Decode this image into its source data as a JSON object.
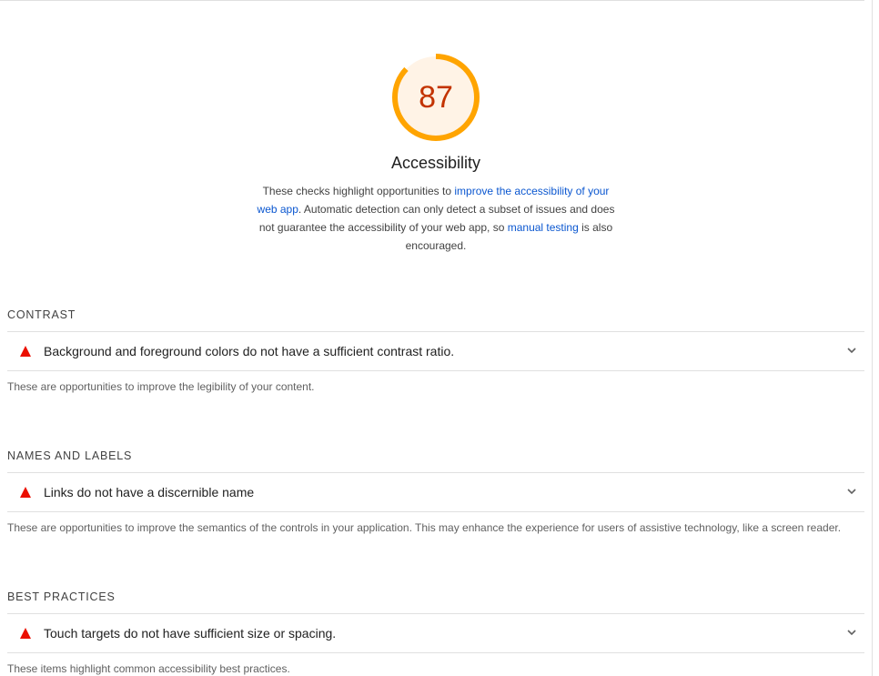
{
  "gauge": {
    "score": "87",
    "score_fraction": 0.87,
    "ring_color": "#ffa400",
    "fill_color": "#fff3e6",
    "text_color": "#c33300"
  },
  "category": {
    "title": "Accessibility",
    "description": {
      "part1": "These checks highlight opportunities to ",
      "link1": "improve the accessibility of your web app",
      "part2": ". Automatic detection can only detect a subset of issues and does not guarantee the accessibility of your web app, so ",
      "link2": "manual testing",
      "part3": " is also encouraged."
    }
  },
  "groups": [
    {
      "heading": "CONTRAST",
      "audit_title": "Background and foreground colors do not have a sufficient contrast ratio.",
      "audit_status_icon": "fail-triangle-icon",
      "expand_icon": "chevron-down-icon",
      "description": "These are opportunities to improve the legibility of your content."
    },
    {
      "heading": "NAMES AND LABELS",
      "audit_title": "Links do not have a discernible name",
      "audit_status_icon": "fail-triangle-icon",
      "expand_icon": "chevron-down-icon",
      "description": "These are opportunities to improve the semantics of the controls in your application. This may enhance the experience for users of assistive technology, like a screen reader."
    },
    {
      "heading": "BEST PRACTICES",
      "audit_title": "Touch targets do not have sufficient size or spacing.",
      "audit_status_icon": "fail-triangle-icon",
      "expand_icon": "chevron-down-icon",
      "description": "These items highlight common accessibility best practices."
    }
  ]
}
